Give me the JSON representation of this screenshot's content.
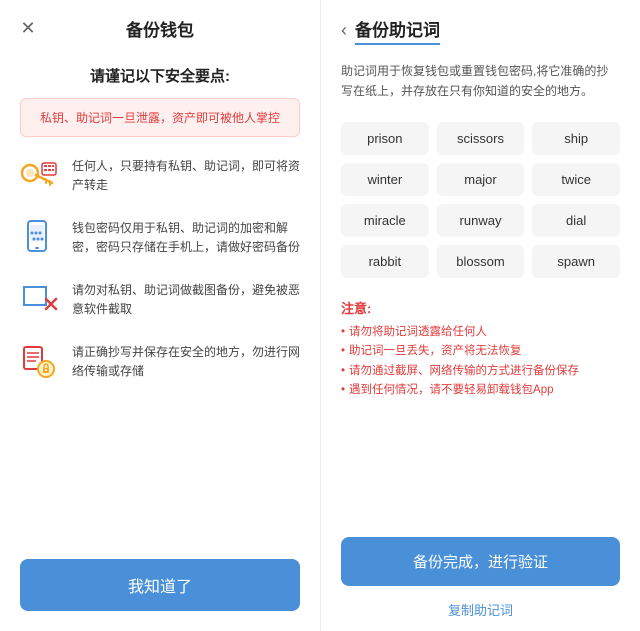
{
  "left": {
    "title": "备份钱包",
    "subtitle": "请谨记以下安全要点:",
    "warning": "私钥、助记词一旦泄露，资产即可被他人掌控",
    "tips": [
      {
        "id": "tip-key",
        "text": "任何人，只要持有私钥、助记词，即可将资产转走",
        "icon": "key-calc-icon"
      },
      {
        "id": "tip-password",
        "text": "钱包密码仅用于私钥、助记词的加密和解密，密码只存储在手机上，请做好密码备份",
        "icon": "phone-lock-icon"
      },
      {
        "id": "tip-screenshot",
        "text": "请勿对私钥、助记词做截图备份，避免被恶意软件截取",
        "icon": "screenshot-x-icon"
      },
      {
        "id": "tip-copy",
        "text": "请正确抄写并保存在安全的地方，勿进行网络传输或存储",
        "icon": "copy-safe-icon"
      }
    ],
    "button": "我知道了"
  },
  "right": {
    "title": "备份助记词",
    "back_btn": "‹",
    "description": "助记词用于恢复钱包或重置钱包密码,将它准确的抄写在纸上，并存放在只有你知道的安全的地方。",
    "words": [
      "prison",
      "scissors",
      "ship",
      "winter",
      "major",
      "twice",
      "miracle",
      "runway",
      "dial",
      "rabbit",
      "blossom",
      "spawn"
    ],
    "notice_title": "注意:",
    "notices": [
      "请勿将助记词透露给任何人",
      "助记词一旦丢失，资产将无法恢复",
      "请勿通过截屏、网络传输的方式进行备份保存",
      "遇到任何情况，请不要轻易卸载钱包App"
    ],
    "confirm_button": "备份完成，进行验证",
    "copy_link": "复制助记词"
  },
  "colors": {
    "accent": "#4a90d9",
    "danger": "#e03c3c",
    "bg_chip": "#f5f5f5"
  }
}
